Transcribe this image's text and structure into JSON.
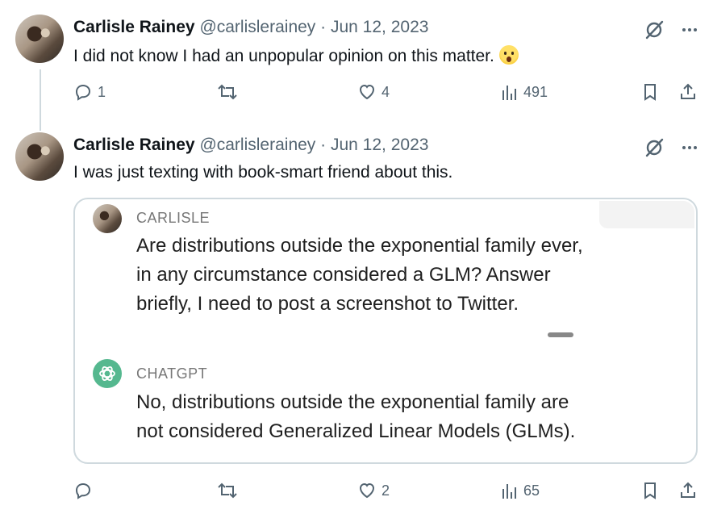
{
  "tweets": [
    {
      "author_name": "Carlisle Rainey",
      "author_handle": "@carlislerainey",
      "date": "· Jun 12, 2023",
      "text": "I did not know I had an unpopular opinion on this matter.",
      "emoji": "astonished-face",
      "replies": "1",
      "retweets": "",
      "likes": "4",
      "views": "491"
    },
    {
      "author_name": "Carlisle Rainey",
      "author_handle": "@carlislerainey",
      "date": "· Jun 12, 2023",
      "text": "I was just texting with book-smart friend about this.",
      "replies": "",
      "retweets": "",
      "likes": "2",
      "views": "65",
      "quote": {
        "user_label": "CARLISLE",
        "user_message": [
          "Are distributions outside the exponential family ever,",
          "in any circumstance considered a GLM? Answer",
          "briefly, I need to post a screenshot to Twitter."
        ],
        "bot_label": "CHATGPT",
        "bot_message": [
          "No, distributions outside the exponential family are",
          "not considered Generalized Linear Models (GLMs)."
        ]
      }
    }
  ],
  "colors": {
    "text": "#0f1419",
    "muted": "#536471",
    "border": "#cfd9de",
    "chatgpt_green": "#55b88f"
  }
}
